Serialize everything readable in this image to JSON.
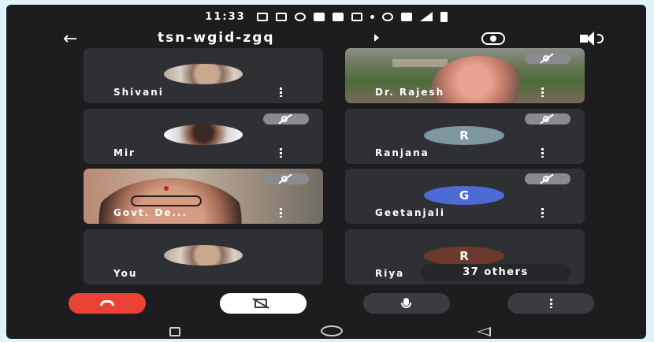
{
  "status_bar": {
    "time": "11:33"
  },
  "top_bar": {
    "meeting_code": "tsn-wgid-zgq"
  },
  "participants": [
    {
      "name": "Shivani",
      "tile": "avatar-photo",
      "muted": false
    },
    {
      "name": "Dr. Rajesh",
      "tile": "video",
      "muted": true
    },
    {
      "name": "Mir",
      "tile": "avatar-photo",
      "muted": true
    },
    {
      "name": "Ranjana",
      "tile": "letter",
      "letter": "R",
      "avatar_color": "#7d96a0",
      "muted": true
    },
    {
      "name": "Govt. De...",
      "tile": "video",
      "muted": true
    },
    {
      "name": "Geetanjali",
      "tile": "letter",
      "letter": "G",
      "avatar_color": "#4d6bd6",
      "muted": true
    },
    {
      "name": "You",
      "tile": "avatar-photo",
      "muted": false
    },
    {
      "name": "Riya",
      "tile": "letter",
      "letter": "R",
      "avatar_color": "#6b3a2c",
      "muted": false
    }
  ],
  "others_label": "37 others",
  "controls": {
    "end_call": "end-call",
    "camera": "camera-off",
    "mic": "microphone",
    "more": "more-options"
  },
  "colors": {
    "end_call": "#ea4335",
    "tile_bg": "#2f3033",
    "app_bg": "#1d1d1f"
  }
}
